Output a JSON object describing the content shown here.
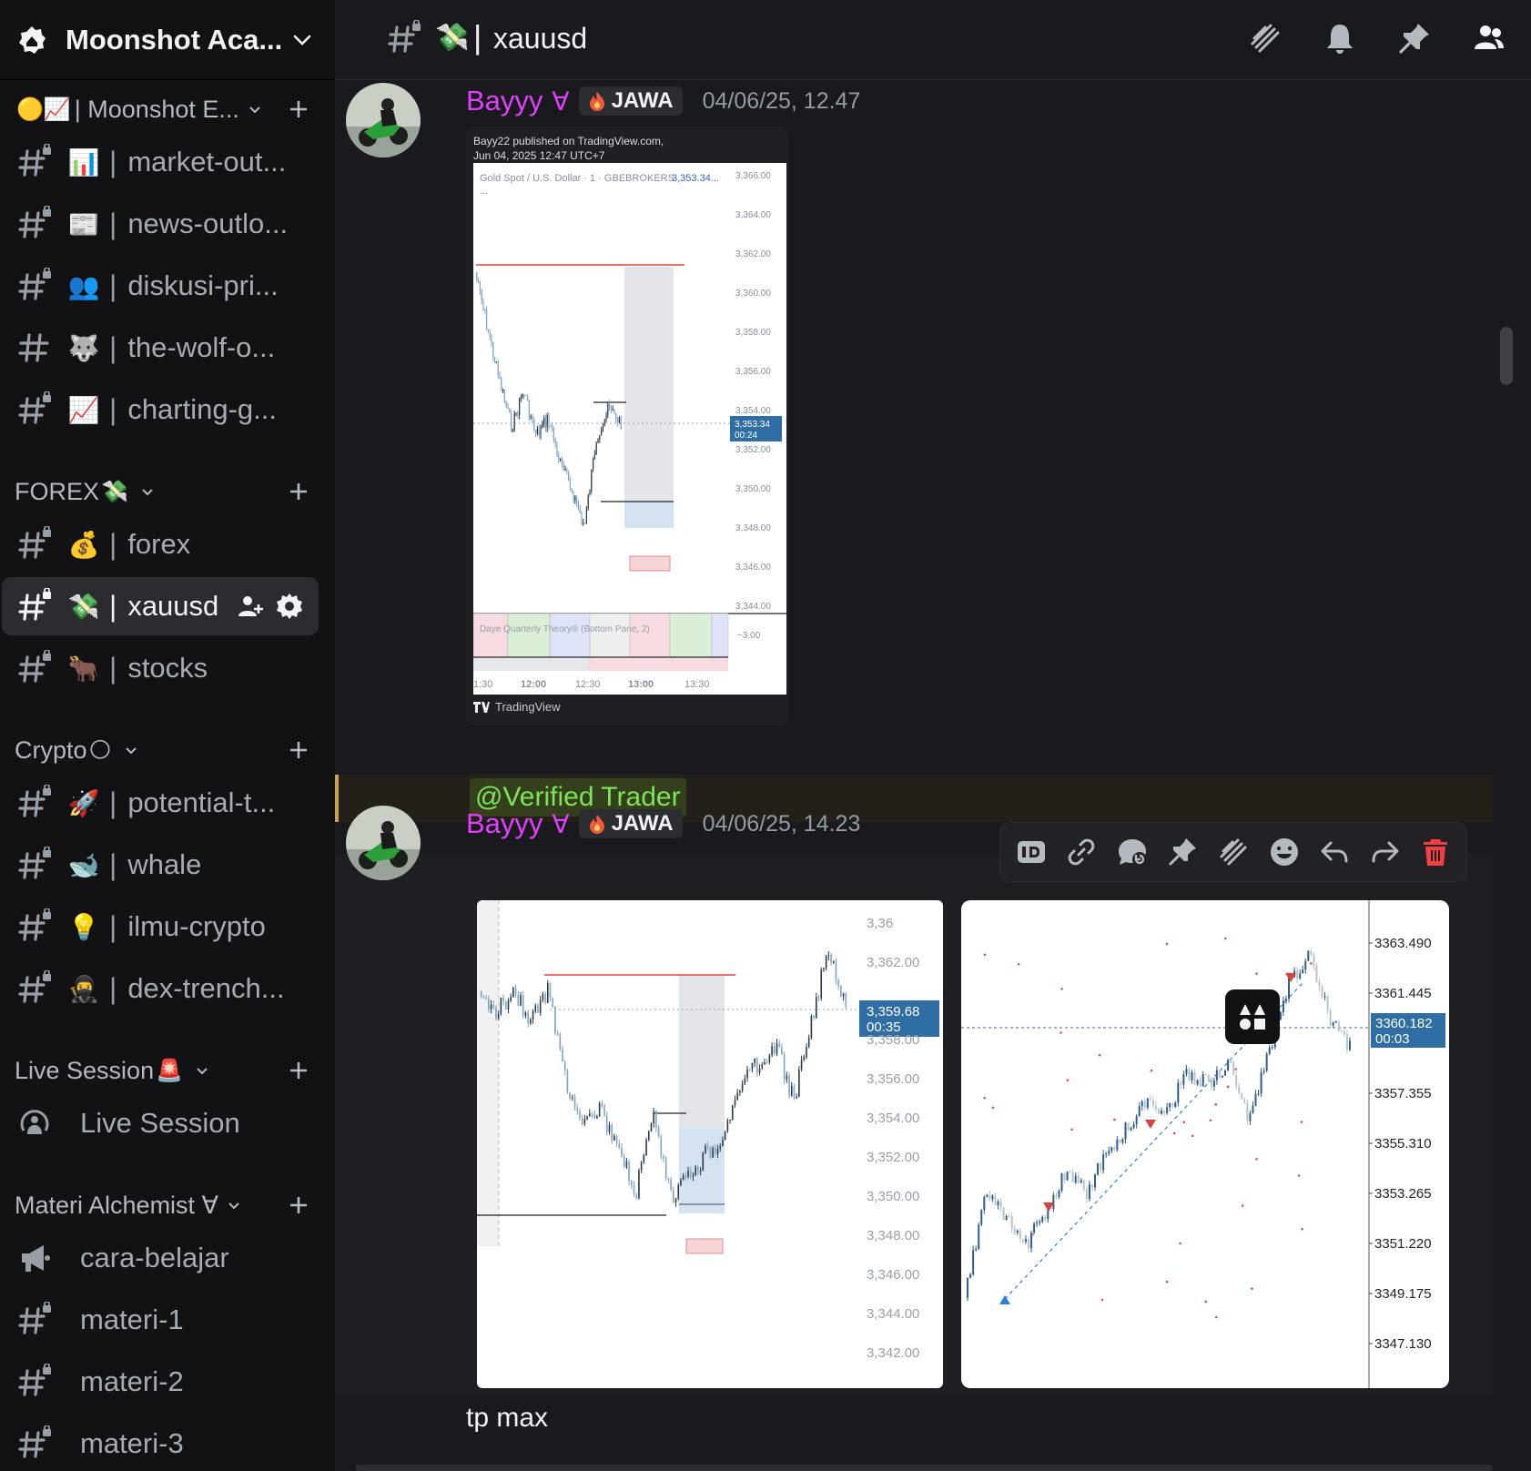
{
  "server": {
    "name": "Moonshot Aca..."
  },
  "categories": {
    "moonshot": {
      "emoji": "🟡📈",
      "label": "| Moonshot E..."
    },
    "forex": {
      "label": "FOREX",
      "emoji": "💸"
    },
    "crypto": {
      "label": "Crypto",
      "emoji": "🌕"
    },
    "live": {
      "label": "Live Session",
      "emoji": "🚨"
    },
    "materi": {
      "label": "Materi Alchemist ∀"
    }
  },
  "channels": [
    {
      "emoji": "📊",
      "sep": "|",
      "name": "market-out..."
    },
    {
      "emoji": "📰",
      "sep": "|",
      "name": "news-outlo..."
    },
    {
      "emoji": "👥",
      "sep": "|",
      "name": "diskusi-pri..."
    },
    {
      "emoji": "🐺",
      "sep": "|",
      "name": "the-wolf-o..."
    },
    {
      "emoji": "📈",
      "sep": "|",
      "name": "charting-g..."
    },
    {
      "emoji": "💰",
      "sep": "|",
      "name": "forex"
    },
    {
      "emoji": "💸",
      "sep": "|",
      "name": "xauusd"
    },
    {
      "emoji": "🐂",
      "sep": "|",
      "name": "stocks"
    },
    {
      "emoji": "🚀",
      "sep": "|",
      "name": "potential-t..."
    },
    {
      "emoji": "🐋",
      "sep": "|",
      "name": "whale"
    },
    {
      "emoji": "💡",
      "sep": "|",
      "name": "ilmu-crypto"
    },
    {
      "emoji": "🥷",
      "sep": "|",
      "name": "dex-trench..."
    },
    {
      "name": "Live Session"
    },
    {
      "name": "cara-belajar"
    },
    {
      "name": "materi-1"
    },
    {
      "name": "materi-2"
    },
    {
      "name": "materi-3"
    }
  ],
  "topbar": {
    "emoji": "💸",
    "sep": "|",
    "channel": "xauusd"
  },
  "messages": [
    {
      "author": "Bayyy",
      "author_symbol": "∀",
      "role": "JAWA",
      "timestamp": "04/06/25, 12.47",
      "embed": {
        "published": "Bayy22 published on TradingView.com,",
        "published_date": "Jun 04, 2025 12:47 UTC+7",
        "symbol_line": "Gold Spot / U.S. Dollar · 1 · GBEBROKERS",
        "symbol_price": "3,353.34...",
        "symbol_more": "...",
        "price_axis": [
          "3,366.00",
          "3,364.00",
          "3,362.00",
          "3,360.00",
          "3,358.00",
          "3,356.00",
          "3,354.00",
          "3,352.00",
          "3,350.00",
          "3,348.00",
          "3,346.00",
          "3,344.00"
        ],
        "price_tag": "3,353.34",
        "price_timer": "00:24",
        "indicator": "Daye Quarterly Theory® (Bottom Pane, 2)",
        "indicator_value": "−3.00",
        "time_axis": [
          "1:30",
          "12:00",
          "12:30",
          "13:00",
          "13:30"
        ],
        "footer": "TradingView"
      }
    },
    {
      "mention": "@Verified Trader"
    },
    {
      "author": "Bayyy",
      "author_symbol": "∀",
      "role": "JAWA",
      "timestamp": "04/06/25, 14.23",
      "image1": {
        "price_axis": [
          "3,36",
          "3,362.00",
          "3,358.00",
          "3,356.00",
          "3,354.00",
          "3,352.00",
          "3,350.00",
          "3,348.00",
          "3,346.00",
          "3,344.00",
          "3,342.00"
        ],
        "price_tag": "3,359.68",
        "price_timer": "00:35"
      },
      "image2": {
        "price_axis": [
          "3363.490",
          "3361.445",
          "3357.355",
          "3355.310",
          "3353.265",
          "3351.220",
          "3349.175",
          "3347.130"
        ],
        "price_tag": "3360.182",
        "price_timer": "00:03"
      },
      "text": "tp max"
    }
  ],
  "colors": {
    "author": "#e040fb",
    "mention_bg": "#34401c",
    "mention_text": "#7ee25a",
    "active_channel_bg": "#2b2b30",
    "delete": "#f23f43"
  }
}
